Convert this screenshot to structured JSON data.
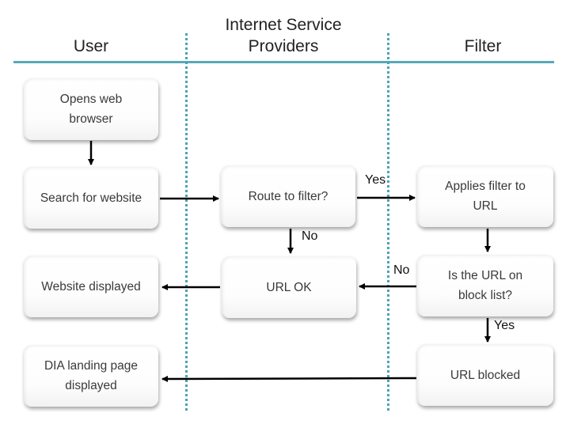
{
  "lanes": [
    {
      "title": "User"
    },
    {
      "title": "Internet Service Providers"
    },
    {
      "title": "Filter"
    }
  ],
  "nodes": {
    "opens_browser": "Opens web browser",
    "search_website": "Search for website",
    "route_to_filter": "Route to filter?",
    "applies_filter": "Applies filter to URL",
    "url_ok": "URL OK",
    "website_displayed": "Website displayed",
    "on_block_list": "Is the URL on block list?",
    "url_blocked": "URL blocked",
    "dia_landing": "DIA landing page displayed"
  },
  "edge_labels": {
    "route_yes": "Yes",
    "route_no": "No",
    "block_no": "No",
    "block_yes": "Yes"
  },
  "colors": {
    "lane_line": "#5aa9b6",
    "arrow": "#000000"
  }
}
